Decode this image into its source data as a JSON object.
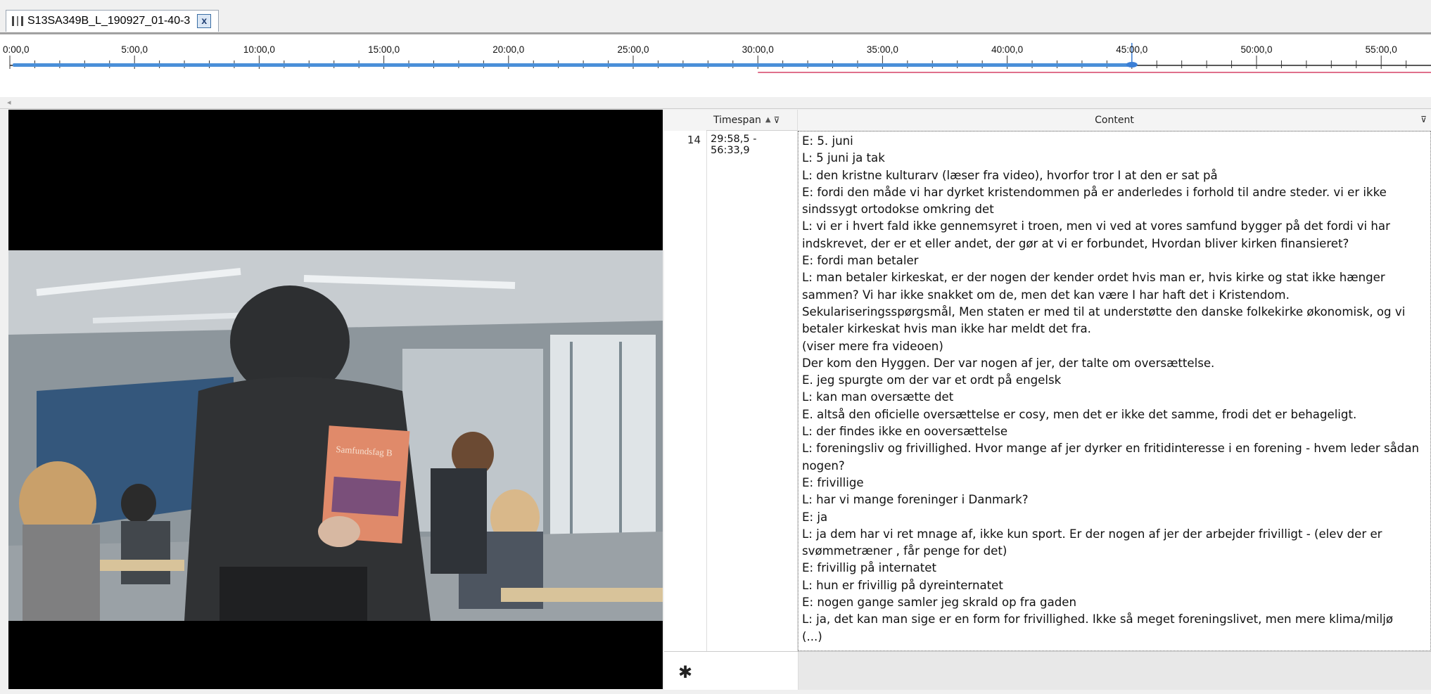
{
  "tab": {
    "title": "S13SA349B_L_190927_01-40-3",
    "close_glyph": "x"
  },
  "timeline": {
    "ticks": [
      "0:00,0",
      "5:00,0",
      "10:00,0",
      "15:00,0",
      "20:00,0",
      "25:00,0",
      "30:00,0",
      "35:00,0",
      "40:00,0",
      "45:00,0",
      "50:00,0",
      "55:00,0"
    ],
    "played_until": "45:00,0",
    "playhead": "45:00,0",
    "segment_start": "30:00,0",
    "colors": {
      "played": "#4a8fd8",
      "segment": "#e0708c",
      "playhead": "#3b7fd6"
    }
  },
  "grid": {
    "col_timespan": "Timespan",
    "col_content": "Content",
    "sort_glyph": "▲",
    "filter_glyph": "⊽",
    "new_row_glyph": "✱",
    "row": {
      "number": "14",
      "timespan": "29:58,5 - 56:33,9",
      "lines": [
        "E: 5. juni",
        "L: 5 juni ja tak",
        "L: den kristne kulturarv (læser fra video), hvorfor tror I at den er sat på",
        "E: fordi den måde vi har dyrket kristendommen på er anderledes i forhold til andre steder. vi er ikke",
        "sindssygt ortodokse omkring det",
        "L: vi er i hvert fald ikke gennemsyret i troen, men vi ved at vores samfund bygger på det fordi vi har",
        "indskrevet, der er et eller andet, der gør at vi er forbundet, Hvordan bliver kirken finansieret?",
        "E: fordi man betaler",
        "L: man betaler kirkeskat, er der nogen der kender ordet hvis man er, hvis kirke og stat ikke hænger",
        "sammen? Vi har ikke snakket om de, men det kan være I har haft det i Kristendom.",
        "Sekulariseringsspørgsmål, Men staten er med til at understøtte den danske folkekirke økonomisk, og vi",
        "betaler kirkeskat hvis man ikke har meldt det fra.",
        "(viser mere fra videoen)",
        "Der kom den Hyggen. Der var nogen af jer, der talte om oversættelse.",
        "E. jeg spurgte om der var et ordt på engelsk",
        "L: kan man oversætte det",
        "E. altså den oficielle oversættelse er cosy, men det er ikke det samme, frodi det er behageligt.",
        "L: der findes ikke en ooversættelse",
        "L: foreningsliv og frivillighed. Hvor mange af jer dyrker en fritidinteresse i en forening - hvem leder sådan",
        "nogen?",
        "E: frivillige",
        "L: har vi mange foreninger i Danmark?",
        "E: ja",
        "L: ja dem har vi ret mnage af, ikke kun sport. Er der nogen af jer der arbejder frivilligt - (elev der er",
        "svømmetræner , får penge for det)",
        "E: frivillig på internatet",
        "L: hun er frivillig på dyreinternatet",
        "E: nogen gange samler jeg skrald op fra gaden",
        "L: ja, det kan man sige er en form for frivillighed. Ikke så meget foreningslivet, men mere klima/miljø",
        "(...)"
      ]
    }
  },
  "video": {
    "book_title": "Samfundsfag B"
  }
}
